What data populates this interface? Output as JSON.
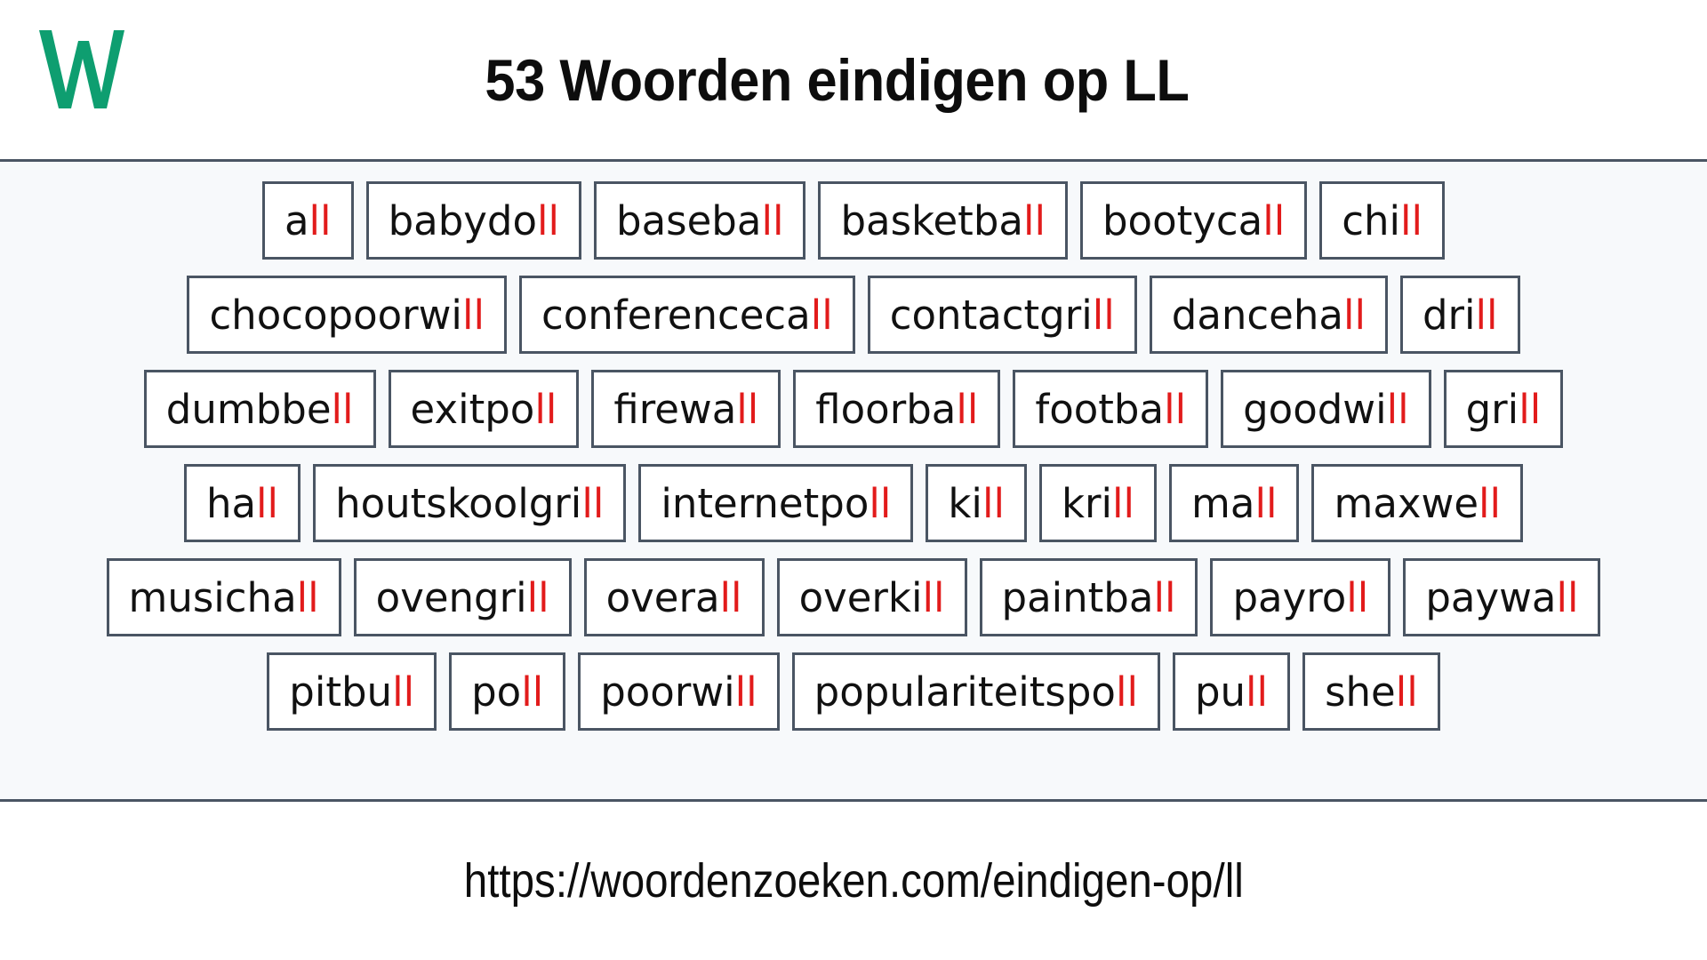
{
  "header": {
    "logo_letter": "W",
    "logo_color": "#0e9e70",
    "title": "53 Woorden eindigen op LL"
  },
  "theme": {
    "page_background": "#ffffff",
    "grid_background": "#f7f9fb",
    "box_background": "#ffffff",
    "box_border": "#4a5563",
    "text_color": "#111111",
    "suffix_color": "#e21b1b"
  },
  "word_list": {
    "suffix": "ll",
    "total_count": 53,
    "rows": [
      [
        {
          "word": "all",
          "stem": "a",
          "suffix": "ll"
        },
        {
          "word": "babydoll",
          "stem": "babydo",
          "suffix": "ll"
        },
        {
          "word": "baseball",
          "stem": "baseba",
          "suffix": "ll"
        },
        {
          "word": "basketball",
          "stem": "basketba",
          "suffix": "ll"
        },
        {
          "word": "bootycall",
          "stem": "bootyca",
          "suffix": "ll"
        },
        {
          "word": "chill",
          "stem": "chi",
          "suffix": "ll"
        }
      ],
      [
        {
          "word": "chocopoorwill",
          "stem": "chocopoorwi",
          "suffix": "ll"
        },
        {
          "word": "conferencecall",
          "stem": "conferenceca",
          "suffix": "ll"
        },
        {
          "word": "contactgrill",
          "stem": "contactgri",
          "suffix": "ll"
        },
        {
          "word": "dancehall",
          "stem": "danceha",
          "suffix": "ll"
        },
        {
          "word": "drill",
          "stem": "dri",
          "suffix": "ll"
        }
      ],
      [
        {
          "word": "dumbbell",
          "stem": "dumbbe",
          "suffix": "ll"
        },
        {
          "word": "exitpoll",
          "stem": "exitpo",
          "suffix": "ll"
        },
        {
          "word": "firewall",
          "stem": "firewa",
          "suffix": "ll"
        },
        {
          "word": "floorball",
          "stem": "floorba",
          "suffix": "ll"
        },
        {
          "word": "football",
          "stem": "footba",
          "suffix": "ll"
        },
        {
          "word": "goodwill",
          "stem": "goodwi",
          "suffix": "ll"
        },
        {
          "word": "grill",
          "stem": "gri",
          "suffix": "ll"
        }
      ],
      [
        {
          "word": "hall",
          "stem": "ha",
          "suffix": "ll"
        },
        {
          "word": "houtskoolgrill",
          "stem": "houtskoolgri",
          "suffix": "ll"
        },
        {
          "word": "internetpoll",
          "stem": "internetpo",
          "suffix": "ll"
        },
        {
          "word": "kill",
          "stem": "ki",
          "suffix": "ll"
        },
        {
          "word": "krill",
          "stem": "kri",
          "suffix": "ll"
        },
        {
          "word": "mall",
          "stem": "ma",
          "suffix": "ll"
        },
        {
          "word": "maxwell",
          "stem": "maxwe",
          "suffix": "ll"
        }
      ],
      [
        {
          "word": "musichall",
          "stem": "musicha",
          "suffix": "ll"
        },
        {
          "word": "ovengrill",
          "stem": "ovengri",
          "suffix": "ll"
        },
        {
          "word": "overall",
          "stem": "overa",
          "suffix": "ll"
        },
        {
          "word": "overkill",
          "stem": "overki",
          "suffix": "ll"
        },
        {
          "word": "paintball",
          "stem": "paintba",
          "suffix": "ll"
        },
        {
          "word": "payroll",
          "stem": "payro",
          "suffix": "ll"
        },
        {
          "word": "paywall",
          "stem": "paywa",
          "suffix": "ll"
        }
      ],
      [
        {
          "word": "pitbull",
          "stem": "pitbu",
          "suffix": "ll"
        },
        {
          "word": "poll",
          "stem": "po",
          "suffix": "ll"
        },
        {
          "word": "poorwill",
          "stem": "poorwi",
          "suffix": "ll"
        },
        {
          "word": "populariteitspoll",
          "stem": "populariteitspo",
          "suffix": "ll"
        },
        {
          "word": "pull",
          "stem": "pu",
          "suffix": "ll"
        },
        {
          "word": "shell",
          "stem": "she",
          "suffix": "ll"
        }
      ]
    ]
  },
  "footer": {
    "url": "https://woordenzoeken.com/eindigen-op/ll"
  }
}
